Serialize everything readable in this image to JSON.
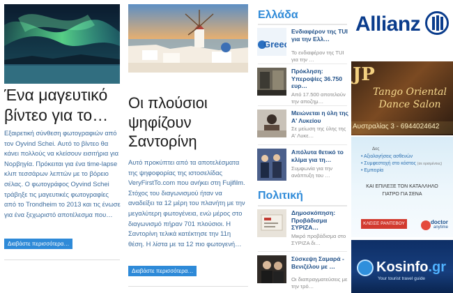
{
  "articles": [
    {
      "title": "Ένα μαγευτικό βίντεο για το…",
      "excerpt": "Εξαιρετική σύνθεση φωτογραφιών από τον Oyvind Schei. Αυτό το βίντεο θα κάνει πολλούς να κλείσουν εισιτήρια για Νορβηγία. Πρόκειται για ένα time-lapse κλιπ τεσσάρων λεπτών με το βόρειο σέλας. Ο φωτογράφος Oyvind Schei τράβηξε τις μαγευτικές φωτογραφίες από το Trondheim το 2013 και τις ένωσε για ένα ξεχωριστό αποτέλεσμα που…",
      "more": "Διαβάστε περισσότερα…"
    },
    {
      "title": "Οι πλούσιοι ψηφίζουν Σαντορίνη",
      "excerpt": "Αυτό προκύπτει από τα αποτελέσματα της ψηφοφορίας της ιστοσελίδας VeryFirstTo.com που ανήκει στη Fujifilm. Στόχος του διαγωνισμού ήταν να αναδείξει τα 12 μέρη του πλανήτη με την μεγαλύτερη φωτογένεια, ενώ μέρος στο διαγωνισμό πήραν 701 πλούσιοι. Η Σαντορίνη τελικά κατέκτησε την 11η θέση. Η λίστα με τα 12 πιο φωτογενή…",
      "more": "Διαβάστε περισσότερα…"
    }
  ],
  "sections": [
    {
      "title": "Ελλάδα",
      "items": [
        {
          "title": "Ενδιαφέρον της TUI για την Ελλ…",
          "snippet": "Το ενδιαφέρον της TUI για την …",
          "thumb_text": "Greece"
        },
        {
          "title": "Πρόκληση: Υπεροψίες 36.750 ευρ…",
          "snippet": "Από 17.500 αποτελούν την αποζημ…"
        },
        {
          "title": "Μειώνεται η ύλη της Α' Λυκείου",
          "snippet": "Σε μείωση της ύλης της Α' Λυκε…"
        },
        {
          "title": "Απόλυτα θετικό το κλίμα για τη…",
          "snippet": "Συμφωνία για την ανάπτυξη του …"
        }
      ]
    },
    {
      "title": "Πολιτική",
      "items": [
        {
          "title": "Δημοσκόπηση: Προβάδισμα ΣΥΡΙΖΑ…",
          "snippet": "Μικρό προβάδισμα στο ΣΥΡΙΖΑ δι…"
        },
        {
          "title": "Σύσκεψη Σαμαρά - Βενιζέλου με …",
          "snippet": "Οι διαπραγματεύσεις με την τρό…"
        }
      ]
    }
  ],
  "ads": {
    "allianz": {
      "brand": "Allianz",
      "color": "#0a3c8c"
    },
    "tango": {
      "monogram": "JP",
      "line1": "Tango Oriental",
      "line2": "Dance Salon",
      "address": "Αυστραλίας 3 - 6944024642"
    },
    "doctor": {
      "header": "Δες",
      "bullets": [
        "Αξιολογήσεις ασθενών",
        "Συμφεστοχή στο κόστος",
        "Εμπειρία"
      ],
      "bullet2_note": "(σε ορισμένους)",
      "tagline1": "ΚΑΙ ΕΠΙΛΕΞΕ ΤΟΝ ΚΑΤΑΛΛΗΛΟ",
      "tagline2": "ΓΙΑΤΡΟ ΓΙΑ ΣΕΝΑ",
      "cta": "ΚΛΕΙΣΕ ΡΑΝΤΕΒΟΥ",
      "brand": "doctor",
      "brand_sub": "anytime"
    },
    "kosinfo": {
      "brand": "Kosinfo",
      "tld": ".gr",
      "tagline": "Your tourist travel guide"
    }
  }
}
